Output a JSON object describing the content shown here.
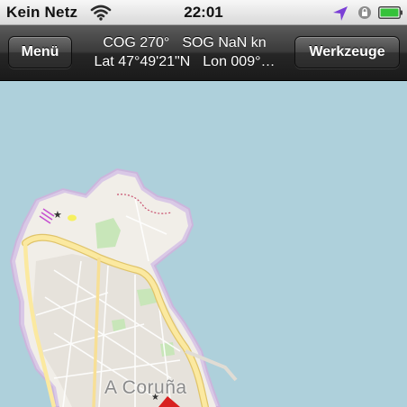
{
  "status_bar": {
    "carrier": "Kein Netz",
    "time": "22:01",
    "icons": [
      "wifi-icon",
      "location-arrow-icon",
      "rotation-lock-icon",
      "battery-icon"
    ],
    "battery_charge": 1.0
  },
  "nav": {
    "menu_label": "Menü",
    "tools_label": "Werkzeuge",
    "cog": "COG 270°",
    "sog": "SOG NaN kn",
    "lat": "Lat 47°49'21\"N",
    "lon": "Lon 009°…"
  },
  "map": {
    "city_label": "A Coruña",
    "colors": {
      "sea": "#aed0db",
      "land": "#f1eee8",
      "coast_halo": "#d9c8e6",
      "main_road": "#fbe9a0",
      "park": "#c8e6b9",
      "marker": "#d82020"
    }
  }
}
